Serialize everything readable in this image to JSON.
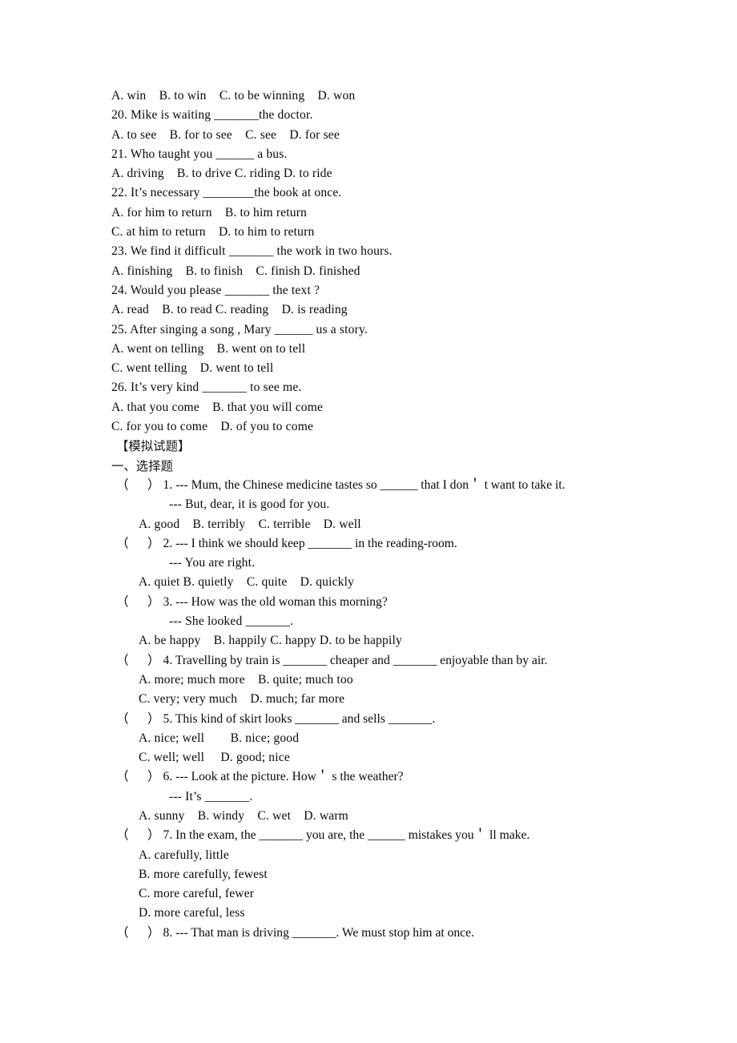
{
  "document": {
    "page_background": "#ffffff",
    "text_color": "#0a0a0a"
  },
  "top_section": {
    "lines": [
      "A. win    B. to win    C. to be winning    D. won",
      "20. Mike is waiting _______the doctor.",
      "A. to see    B. for to see    C. see    D. for see",
      "21. Who taught you ______ a bus.",
      "A. driving    B. to drive C. riding D. to ride",
      "22. It’s necessary ________the book at once.",
      "A. for him to return    B. to him return",
      "C. at him to return    D. to him to return",
      "23. We find it difficult _______ the work in two hours.",
      "A. finishing    B. to finish    C. finish D. finished",
      "24. Would you please _______ the text ?",
      "A. read    B. to read C. reading    D. is reading",
      "25. After singing a song , Mary ______ us a story.",
      "A. went on telling    B. went on to tell",
      "C. went telling    D. went to tell",
      "26. It’s very kind _______ to see me.",
      "A. that you come    B. that you will come",
      "C. for you to come    D. of you to come"
    ]
  },
  "headings": {
    "mock_exam": "【模拟试题】",
    "section_one": "一、选择题"
  },
  "questions": [
    {
      "number": "1.",
      "paren_open": "（",
      "paren_close": "）",
      "stem": "--- Mum, the Chinese medicine tastes so ______ that I don＇ t want to take it.",
      "continuation": "--- But, dear, it is good for you.",
      "option_lines": [
        "A. good    B. terribly    C. terrible    D. well"
      ]
    },
    {
      "number": "2.",
      "paren_open": "（",
      "paren_close": "）",
      "stem": "--- I think we should keep _______ in the reading-room.",
      "continuation": "--- You are right.",
      "option_lines": [
        "A. quiet B. quietly    C. quite    D. quickly"
      ]
    },
    {
      "number": "3.",
      "paren_open": "（",
      "paren_close": "）",
      "stem": "--- How was the old woman this morning?",
      "continuation": "--- She looked _______.",
      "option_lines": [
        "A. be happy    B. happily C. happy D. to be happily"
      ]
    },
    {
      "number": "4.",
      "paren_open": "（",
      "paren_close": "）",
      "stem": "Travelling by train is _______ cheaper and _______ enjoyable than by air.",
      "continuation": null,
      "option_lines": [
        "A. more; much more    B. quite; much too",
        "C. very; very much    D. much; far more"
      ]
    },
    {
      "number": "5.",
      "paren_open": "（",
      "paren_close": "）",
      "stem": "This kind of skirt looks _______ and sells _______.",
      "continuation": null,
      "option_lines": [
        "A. nice; well        B. nice; good",
        "C. well; well     D. good; nice"
      ]
    },
    {
      "number": "6.",
      "paren_open": "（",
      "paren_close": "）",
      "stem": "--- Look at the picture. How＇ s the weather?",
      "continuation": "--- It’s _______.",
      "option_lines": [
        "A. sunny    B. windy    C. wet    D. warm"
      ]
    },
    {
      "number": "7.",
      "paren_open": "（",
      "paren_close": "）",
      "stem": "In the exam, the _______ you are, the ______ mistakes you＇ ll make.",
      "continuation": null,
      "option_lines": [
        "A. carefully, little",
        "B. more carefully, fewest",
        "C. more careful, fewer",
        "D. more careful, less"
      ]
    },
    {
      "number": "8.",
      "paren_open": "（",
      "paren_close": "）",
      "stem": "--- That man is driving _______. We must stop him at once.",
      "continuation": null,
      "option_lines": []
    }
  ]
}
